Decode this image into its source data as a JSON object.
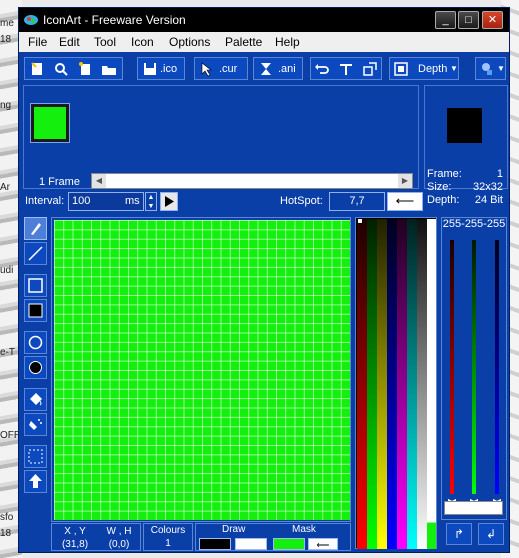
{
  "window": {
    "title": "IconArt - Freeware Version",
    "controls": [
      "_",
      "□",
      "✕"
    ]
  },
  "menubar": {
    "items": [
      "File",
      "Edit",
      "Tool",
      "Icon",
      "Options",
      "Palette",
      "Help"
    ]
  },
  "toolbar": {
    "ico_label": ".ico",
    "cur_label": ".cur",
    "ani_label": ".ani",
    "depth_label": "Depth"
  },
  "frames": {
    "count_label": "1 Frame"
  },
  "info": {
    "frame_label": "Frame:",
    "frame_value": "1",
    "size_label": "Size:",
    "size_value": "32x32",
    "depth_label": "Depth:",
    "depth_value": "24 Bit"
  },
  "interval": {
    "label": "Interval:",
    "value": "100",
    "unit": "ms"
  },
  "hotspot": {
    "label": "HotSpot:",
    "value": "7,7"
  },
  "rgb": {
    "readout": "255-255-255"
  },
  "status": {
    "xy_label": "X , Y",
    "xy_value": "(31,8)",
    "wh_label": "W , H",
    "wh_value": "(0,0)",
    "colours_label": "Colours",
    "colours_value": "1",
    "draw_label": "Draw",
    "mask_label": "Mask"
  },
  "colors": {
    "canvas": "#14ef0e",
    "window_bg": "#0a3fa8",
    "draw_fg": "#000000",
    "draw_bg": "#ffffff"
  },
  "desktop": {
    "left_text": [
      "me",
      "18",
      "ng",
      "Ar",
      "udi",
      "e-T",
      "OFR",
      "sfo",
      "18"
    ]
  }
}
